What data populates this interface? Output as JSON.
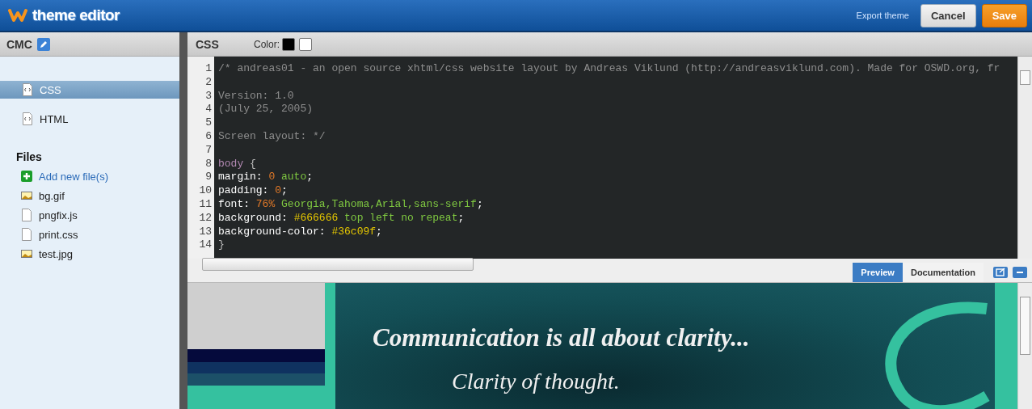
{
  "header": {
    "logo_text": "theme editor",
    "export_link": "Export theme",
    "buttons": [
      {
        "label": "Cancel",
        "kind": "secondary"
      },
      {
        "label": "Save",
        "kind": "primary"
      }
    ]
  },
  "sidebar": {
    "title": "CMC",
    "pages": [
      {
        "label": "CSS",
        "selected": true
      },
      {
        "label": "HTML",
        "selected": false
      }
    ],
    "files_heading": "Files",
    "add_file": "Add new file(s)",
    "files": [
      {
        "name": "bg.gif",
        "kind": "image"
      },
      {
        "name": "pngfix.js",
        "kind": "document"
      },
      {
        "name": "print.css",
        "kind": "document"
      },
      {
        "name": "test.jpg",
        "kind": "image"
      }
    ]
  },
  "editor": {
    "title": "CSS",
    "color_label": "Color:",
    "swatches": [
      {
        "color": "#000000"
      },
      {
        "color": "#ffffff"
      }
    ],
    "lines": [
      {
        "number": "1",
        "tokens": [
          {
            "text": "/* andreas01 - an open source xhtml/css website layout by Andreas Viklund (http://andreasviklund.com). Made for OSWD.org, fr",
            "kind": "comment"
          }
        ]
      },
      {
        "number": "2"
      },
      {
        "number": "3",
        "tokens": [
          {
            "text": "Version: 1.0",
            "kind": "comment"
          }
        ]
      },
      {
        "number": "4",
        "tokens": [
          {
            "text": "(July 25, 2005)",
            "kind": "comment"
          }
        ]
      },
      {
        "number": "5"
      },
      {
        "number": "6",
        "tokens": [
          {
            "text": "Screen layout: */",
            "kind": "comment"
          }
        ]
      },
      {
        "number": "7"
      },
      {
        "number": "8",
        "tokens": [
          {
            "text": "body",
            "kind": "selector"
          },
          {
            "text": " {",
            "kind": "punct"
          }
        ]
      },
      {
        "number": "9",
        "tokens": [
          {
            "text": "margin:",
            "kind": "property"
          },
          {
            "text": " 0",
            "kind": "number"
          },
          {
            "text": " auto",
            "kind": "value"
          },
          {
            "text": ";",
            "kind": "property"
          }
        ]
      },
      {
        "number": "10",
        "tokens": [
          {
            "text": "padding:",
            "kind": "property"
          },
          {
            "text": " 0",
            "kind": "number"
          },
          {
            "text": ";",
            "kind": "property"
          }
        ]
      },
      {
        "number": "11",
        "tokens": [
          {
            "text": "font:",
            "kind": "property"
          },
          {
            "text": " 76%",
            "kind": "number"
          },
          {
            "text": " Georgia,Tahoma,Arial,sans-serif",
            "kind": "value"
          },
          {
            "text": ";",
            "kind": "property"
          }
        ]
      },
      {
        "number": "12",
        "tokens": [
          {
            "text": "background:",
            "kind": "property"
          },
          {
            "text": " #666666",
            "kind": "hex"
          },
          {
            "text": " top left no repeat",
            "kind": "value"
          },
          {
            "text": ";",
            "kind": "property"
          }
        ]
      },
      {
        "number": "13",
        "tokens": [
          {
            "text": "background-color:",
            "kind": "property"
          },
          {
            "text": " #36c09f",
            "kind": "hex"
          },
          {
            "text": ";",
            "kind": "property"
          }
        ]
      },
      {
        "number": "14",
        "tokens": [
          {
            "text": "}",
            "kind": "punct"
          }
        ]
      }
    ]
  },
  "preview_tabs": [
    {
      "label": "Preview",
      "selected": true
    },
    {
      "label": "Documentation",
      "selected": false
    }
  ],
  "preview": {
    "heading": "Communication is all about clarity...",
    "subheading": "Clarity of thought."
  }
}
